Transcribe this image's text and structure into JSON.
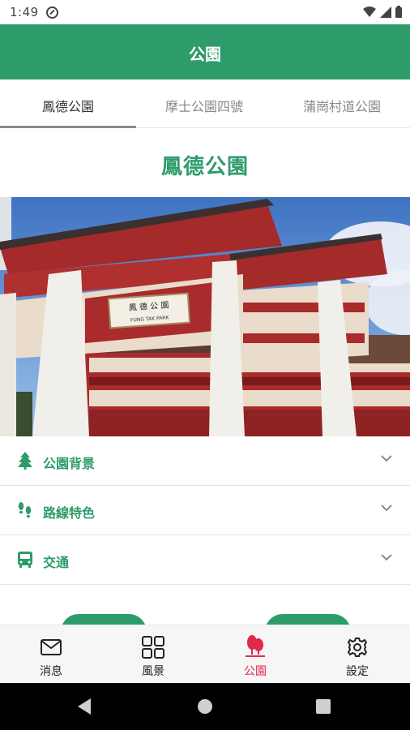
{
  "status_bar": {
    "time": "1:49"
  },
  "app_bar": {
    "title": "公園"
  },
  "tabs": [
    {
      "label": "鳳德公園",
      "active": true
    },
    {
      "label": "摩士公園四號",
      "active": false
    },
    {
      "label": "蒲崗村道公園",
      "active": false
    }
  ],
  "park": {
    "title": "鳳德公園",
    "photo_sign_text": "鳳 德 公 園",
    "photo_sign_subtext": "FUNG TAK PARK"
  },
  "sections": [
    {
      "label": "公園背景",
      "icon": "tree-icon"
    },
    {
      "label": "路線特色",
      "icon": "footprints-icon"
    },
    {
      "label": "交通",
      "icon": "bus-icon"
    }
  ],
  "bottom_nav": [
    {
      "label": "消息",
      "icon": "mail-icon",
      "active": false
    },
    {
      "label": "風景",
      "icon": "grid-icon",
      "active": false
    },
    {
      "label": "公園",
      "icon": "park-trees-icon",
      "active": true
    },
    {
      "label": "設定",
      "icon": "gear-icon",
      "active": false
    }
  ],
  "colors": {
    "primary": "#2e9b6b",
    "active_nav": "#e0284b",
    "text_muted": "#888888"
  }
}
